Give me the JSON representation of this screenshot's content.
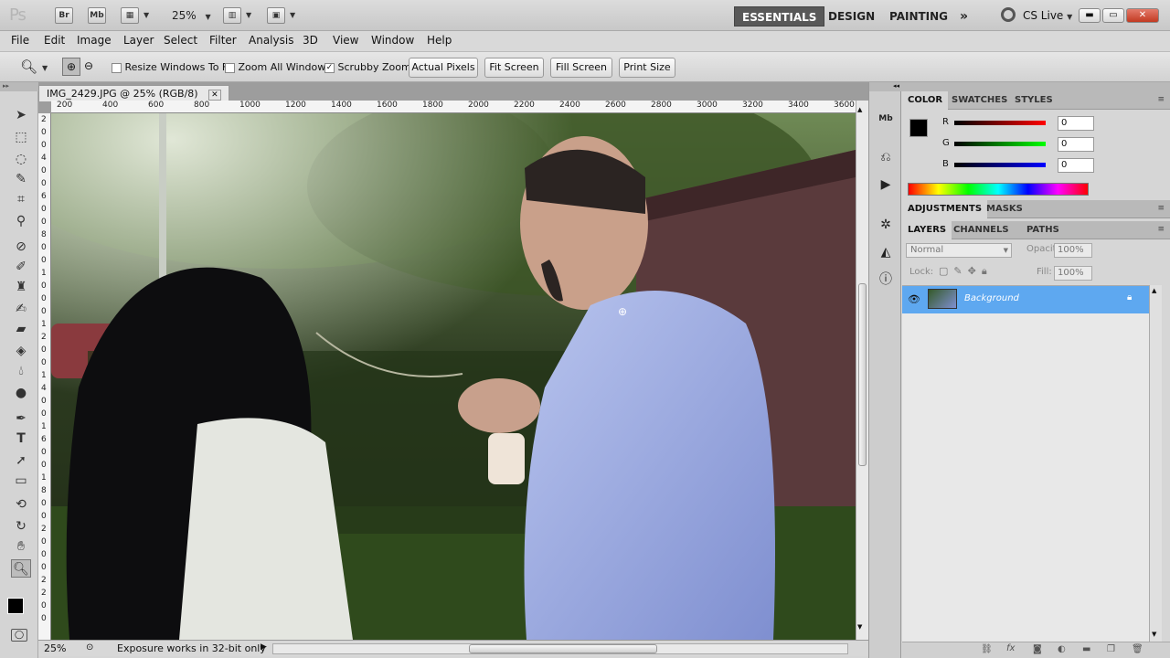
{
  "app": {
    "logo": "Ps",
    "zoom": "25%",
    "br": "Br",
    "mb": "Mb"
  },
  "workspaces": [
    {
      "label": "ESSENTIALS"
    },
    {
      "label": "DESIGN"
    },
    {
      "label": "PAINTING"
    }
  ],
  "cslive": "CS Live",
  "menus": [
    "File",
    "Edit",
    "Image",
    "Layer",
    "Select",
    "Filter",
    "Analysis",
    "3D",
    "View",
    "Window",
    "Help"
  ],
  "options": {
    "resize": "Resize Windows To Fit",
    "zoom_all": "Zoom All Windows",
    "scrubby": "Scrubby Zoom",
    "actual_pixels": "Actual Pixels",
    "fit_screen": "Fit Screen",
    "fill_screen": "Fill Screen",
    "print_size": "Print Size",
    "resize_checked": false,
    "zoom_all_checked": false,
    "scrubby_checked": true
  },
  "document": {
    "tab": "IMG_2429.JPG @ 25% (RGB/8)",
    "hruler": [
      "200",
      "400",
      "600",
      "800",
      "1000",
      "1200",
      "1400",
      "1600",
      "1800",
      "2000",
      "2200",
      "2400",
      "2600",
      "2800",
      "3000",
      "3200",
      "3400",
      "3600"
    ],
    "vruler": [
      "2",
      "0",
      "0",
      "4",
      "0",
      "0",
      "6",
      "0",
      "0",
      "8",
      "0",
      "0",
      "1",
      "0",
      "0",
      "0",
      "1",
      "2",
      "0",
      "0",
      "1",
      "4",
      "0",
      "0",
      "1",
      "6",
      "0",
      "0",
      "1",
      "8",
      "0",
      "0",
      "2",
      "0",
      "0",
      "0",
      "2",
      "2",
      "0",
      "0"
    ],
    "status_zoom": "25%",
    "status_text": "Exposure works in 32-bit only"
  },
  "color_panel": {
    "tabs": [
      "COLOR",
      "SWATCHES",
      "STYLES"
    ],
    "r_label": "R",
    "g_label": "G",
    "b_label": "B",
    "r": "0",
    "g": "0",
    "b": "0"
  },
  "adjust_panel": {
    "tabs": [
      "ADJUSTMENTS",
      "MASKS"
    ]
  },
  "layers_panel": {
    "tabs": [
      "LAYERS",
      "CHANNELS",
      "PATHS"
    ],
    "blend": "Normal",
    "opacity_label": "Opacity:",
    "opacity": "100%",
    "lock_label": "Lock:",
    "fill_label": "Fill:",
    "fill": "100%",
    "layer_name": "Background"
  },
  "colors": {
    "accent": "#3d8ee8",
    "layer_selected": "#5ea8f0"
  }
}
